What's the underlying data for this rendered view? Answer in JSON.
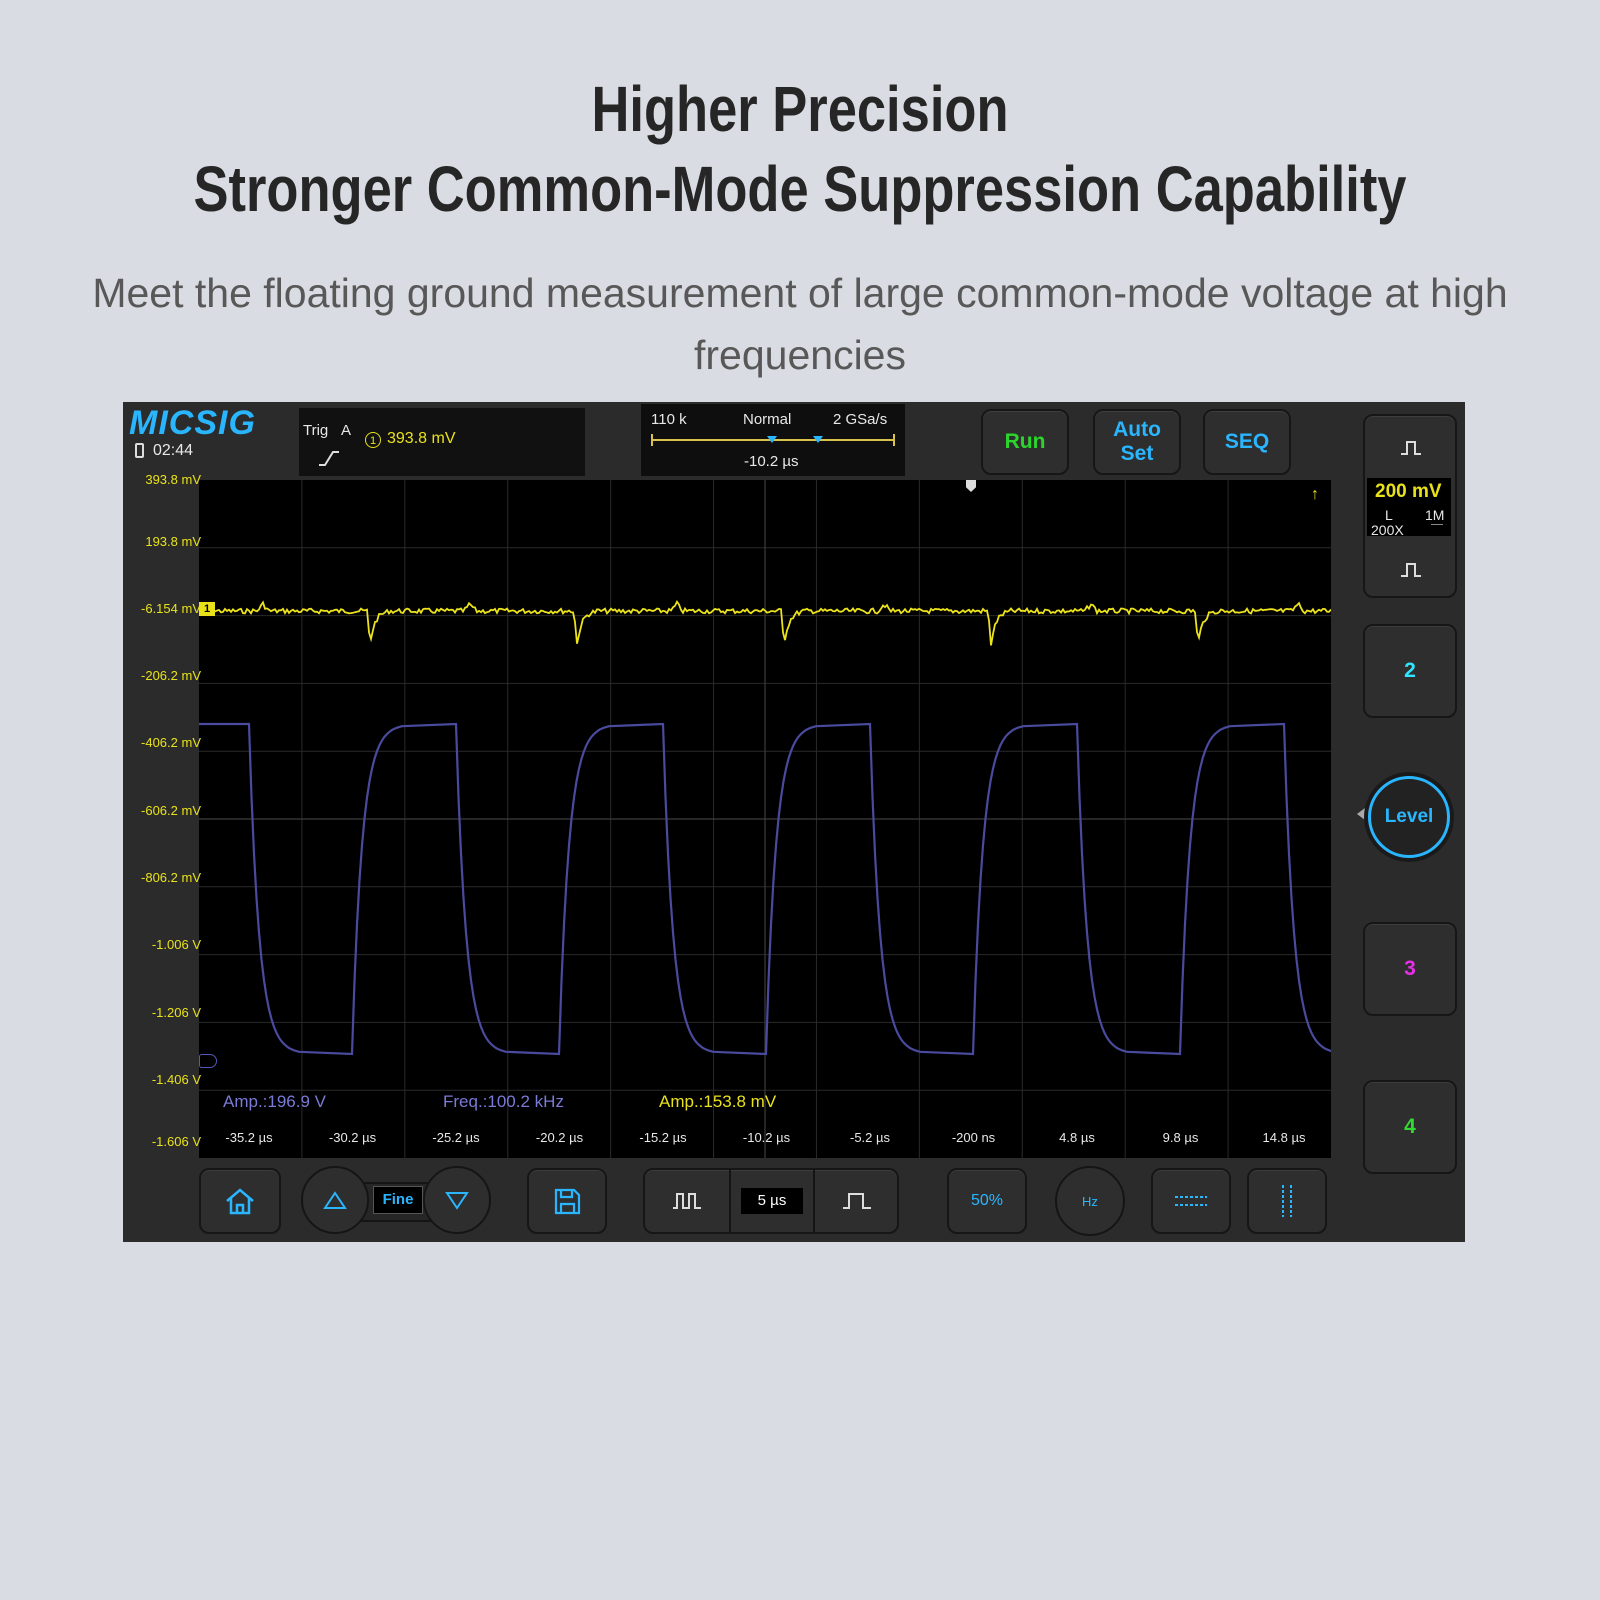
{
  "page": {
    "headline1": "Higher Precision",
    "headline2": "Stronger Common-Mode Suppression Capability",
    "subtitle": "Meet the floating ground measurement of large common-mode voltage at high frequencies"
  },
  "scope": {
    "brand": "Micsig",
    "clock": "02:44",
    "trigger": {
      "label": "Trig",
      "source": "A",
      "channel_mark": "1",
      "level": "393.8  mV"
    },
    "acquisition": {
      "memory": "110 k",
      "mode": "Normal",
      "sample_rate": "2 GSa/s",
      "delay": "-10.2 µs"
    },
    "top_buttons": {
      "run": "Run",
      "auto_set_line1": "Auto",
      "auto_set_line2": "Set",
      "seq": "SEQ"
    },
    "channel1_info": {
      "scale": "200 mV",
      "coupling": "L",
      "impedance": "1M",
      "probe": "200X"
    },
    "side_buttons": {
      "ch2": "2",
      "level": "Level",
      "ch3": "3",
      "ch4": "4"
    },
    "y_ticks": [
      "393.8 mV",
      "193.8 mV",
      "-6.154 mV",
      "-206.2 mV",
      "-406.2 mV",
      "-606.2 mV",
      "-806.2 mV",
      "-1.006 V",
      "-1.206 V",
      "-1.406 V",
      "-1.606 V"
    ],
    "x_ticks": [
      "-35.2 µs",
      "-30.2 µs",
      "-25.2 µs",
      "-20.2 µs",
      "-15.2 µs",
      "-10.2 µs",
      "-5.2 µs",
      "-200 ns",
      "4.8 µs",
      "9.8 µs",
      "14.8 µs"
    ],
    "ch1_marker": "1",
    "measurements": {
      "amp_a": "Amp.:196.9 V",
      "freq": "Freq.:100.2 kHz",
      "amp_b": "Amp.:153.8 mV"
    },
    "bottom": {
      "fine": "Fine",
      "timebase": "5 µs",
      "fifty": "50%",
      "hz": "Hz"
    },
    "colors": {
      "ch1": "#ece31c",
      "math": "#4a4a9e",
      "accent": "#2ab6ff",
      "run": "#2bd52b",
      "ch2": "#2ee6ff",
      "ch3": "#e82ee8",
      "ch4": "#32d932"
    }
  }
}
